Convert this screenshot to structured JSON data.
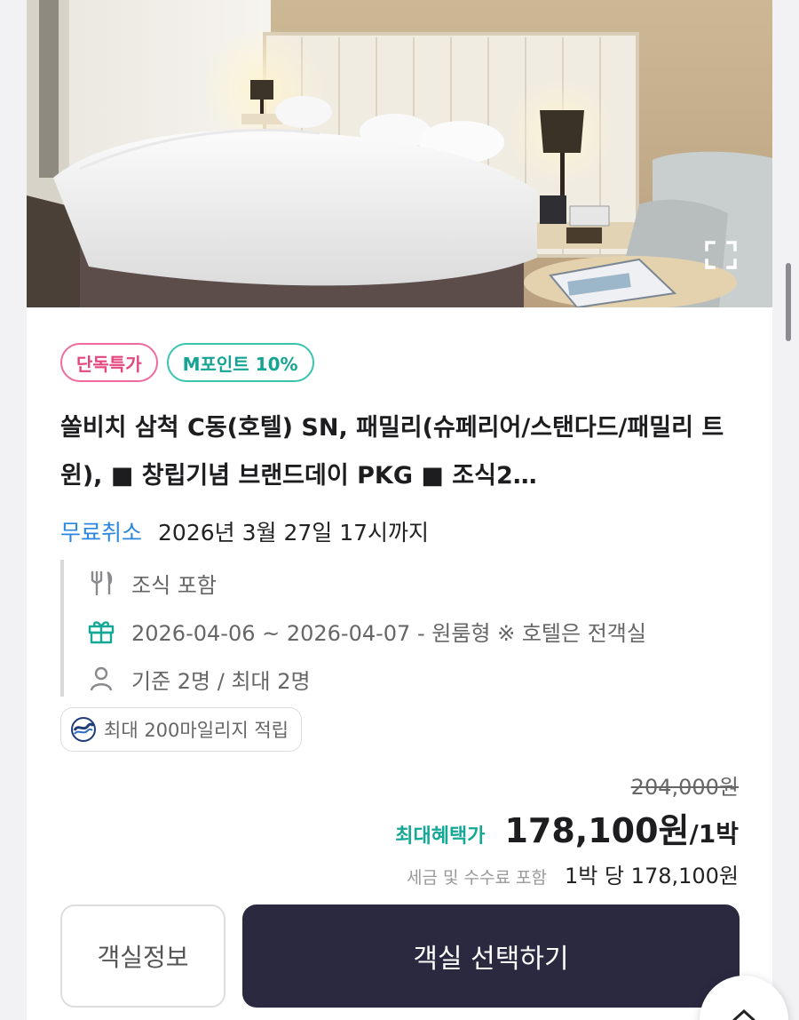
{
  "photo": {
    "alt": "쏠비치 삼척 C동 객실 사진",
    "expand_icon": "fullscreen-icon"
  },
  "badges": [
    {
      "label": "단독특가",
      "color": "#e4467f"
    },
    {
      "label": "M포인트 10%",
      "color": "#15a493"
    }
  ],
  "room": {
    "title": "쏠비치 삼척 C동(호텔) SN, 패밀리(슈페리어/스탠다드/패밀리 트윈), ■ 창립기념 브랜드데이 PKG ■ 조식2…"
  },
  "cancellation": {
    "label": "무료취소",
    "deadline": "2026년 3월 27일 17시까지"
  },
  "details": {
    "meal": {
      "icon": "utensils-icon",
      "text": "조식 포함"
    },
    "stay": {
      "icon": "gift-icon",
      "text": "2026-04-06 ~ 2026-04-07 - 원룸형 ※ 호텔은 전객실"
    },
    "occupancy": {
      "icon": "person-icon",
      "text": "기준 2명 / 최대 2명"
    }
  },
  "mileage": {
    "icon": "airline-logo-icon",
    "text": "최대 200마일리지 적립"
  },
  "price": {
    "original": "204,000원",
    "label": "최대혜택가",
    "amount": "178,100원",
    "unit": "/1박",
    "tax_note": "세금 및 수수료 포함",
    "per_night": "1박 당 178,100원"
  },
  "buttons": {
    "room_info": "객실정보",
    "select_room": "객실 선택하기"
  },
  "colors": {
    "accent_dark": "#2b2940",
    "cancel_blue": "#2b86e0",
    "benefit_teal": "#16a896",
    "badge_pink": "#e4467f"
  }
}
